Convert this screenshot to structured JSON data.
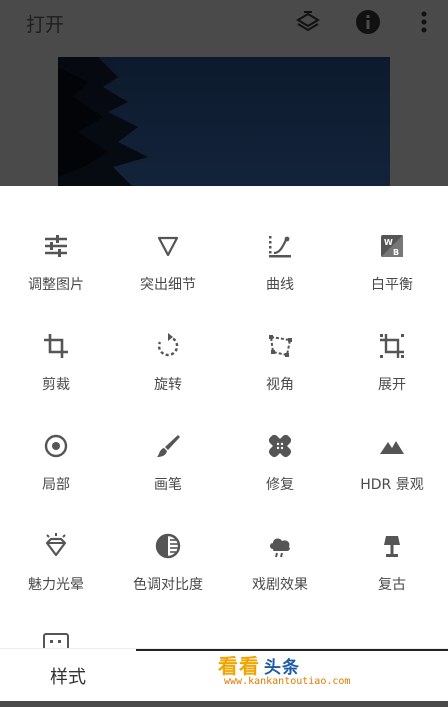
{
  "header": {
    "title": "打开",
    "icons": [
      "layers-icon",
      "info-icon",
      "more-vert-icon"
    ]
  },
  "tools": [
    {
      "label": "调整图片",
      "icon": "tune-sliders-icon"
    },
    {
      "label": "突出细节",
      "icon": "details-triangle-icon"
    },
    {
      "label": "曲线",
      "icon": "curves-icon"
    },
    {
      "label": "白平衡",
      "icon": "white-balance-icon"
    },
    {
      "label": "剪裁",
      "icon": "crop-icon"
    },
    {
      "label": "旋转",
      "icon": "rotate-icon"
    },
    {
      "label": "视角",
      "icon": "perspective-icon"
    },
    {
      "label": "展开",
      "icon": "expand-icon"
    },
    {
      "label": "局部",
      "icon": "selective-target-icon"
    },
    {
      "label": "画笔",
      "icon": "brush-icon"
    },
    {
      "label": "修复",
      "icon": "healing-bandage-icon"
    },
    {
      "label": "HDR 景观",
      "icon": "hdr-mountains-icon"
    },
    {
      "label": "魅力光晕",
      "icon": "glamour-glow-diamond-icon"
    },
    {
      "label": "色调对比度",
      "icon": "tonal-contrast-icon"
    },
    {
      "label": "戏剧效果",
      "icon": "drama-cloud-icon"
    },
    {
      "label": "复古",
      "icon": "vintage-lamp-icon"
    }
  ],
  "bottom_tabs": {
    "styles": "样式"
  },
  "watermark": {
    "title": "看看",
    "subtitle": "头条",
    "url": "www.kankantoutiao.com"
  },
  "colors": {
    "sheet_bg": "#ffffff",
    "icon": "#555555",
    "label": "#4a4a4a",
    "watermark_orange": "#f2a400"
  }
}
